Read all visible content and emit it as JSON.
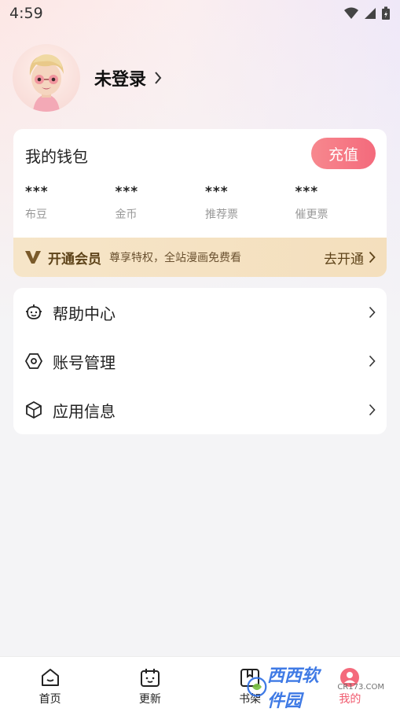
{
  "status_bar": {
    "time": "4:59"
  },
  "profile": {
    "login_label": "未登录"
  },
  "wallet": {
    "title": "我的钱包",
    "recharge_label": "充值",
    "stats": [
      {
        "value": "***",
        "label": "布豆"
      },
      {
        "value": "***",
        "label": "金币"
      },
      {
        "value": "***",
        "label": "推荐票"
      },
      {
        "value": "***",
        "label": "催更票"
      }
    ],
    "vip": {
      "title": "开通会员",
      "desc": "尊享特权，全站漫画免费看",
      "action": "去开通"
    }
  },
  "menu": [
    {
      "label": "帮助中心",
      "icon": "help-bot-icon"
    },
    {
      "label": "账号管理",
      "icon": "hexagon-icon"
    },
    {
      "label": "应用信息",
      "icon": "cube-icon"
    }
  ],
  "tabs": [
    {
      "label": "首页",
      "icon": "home-icon",
      "active": false
    },
    {
      "label": "更新",
      "icon": "calendar-icon",
      "active": false
    },
    {
      "label": "书架",
      "icon": "bookshelf-icon",
      "active": false
    },
    {
      "label": "我的",
      "icon": "profile-icon",
      "active": true
    }
  ],
  "watermark": {
    "text": "西西软件园",
    "sub": "CR173.COM"
  },
  "colors": {
    "accent": "#f46a7c",
    "vip_bg": "#f6e5c8",
    "vip_text": "#5e4319"
  }
}
